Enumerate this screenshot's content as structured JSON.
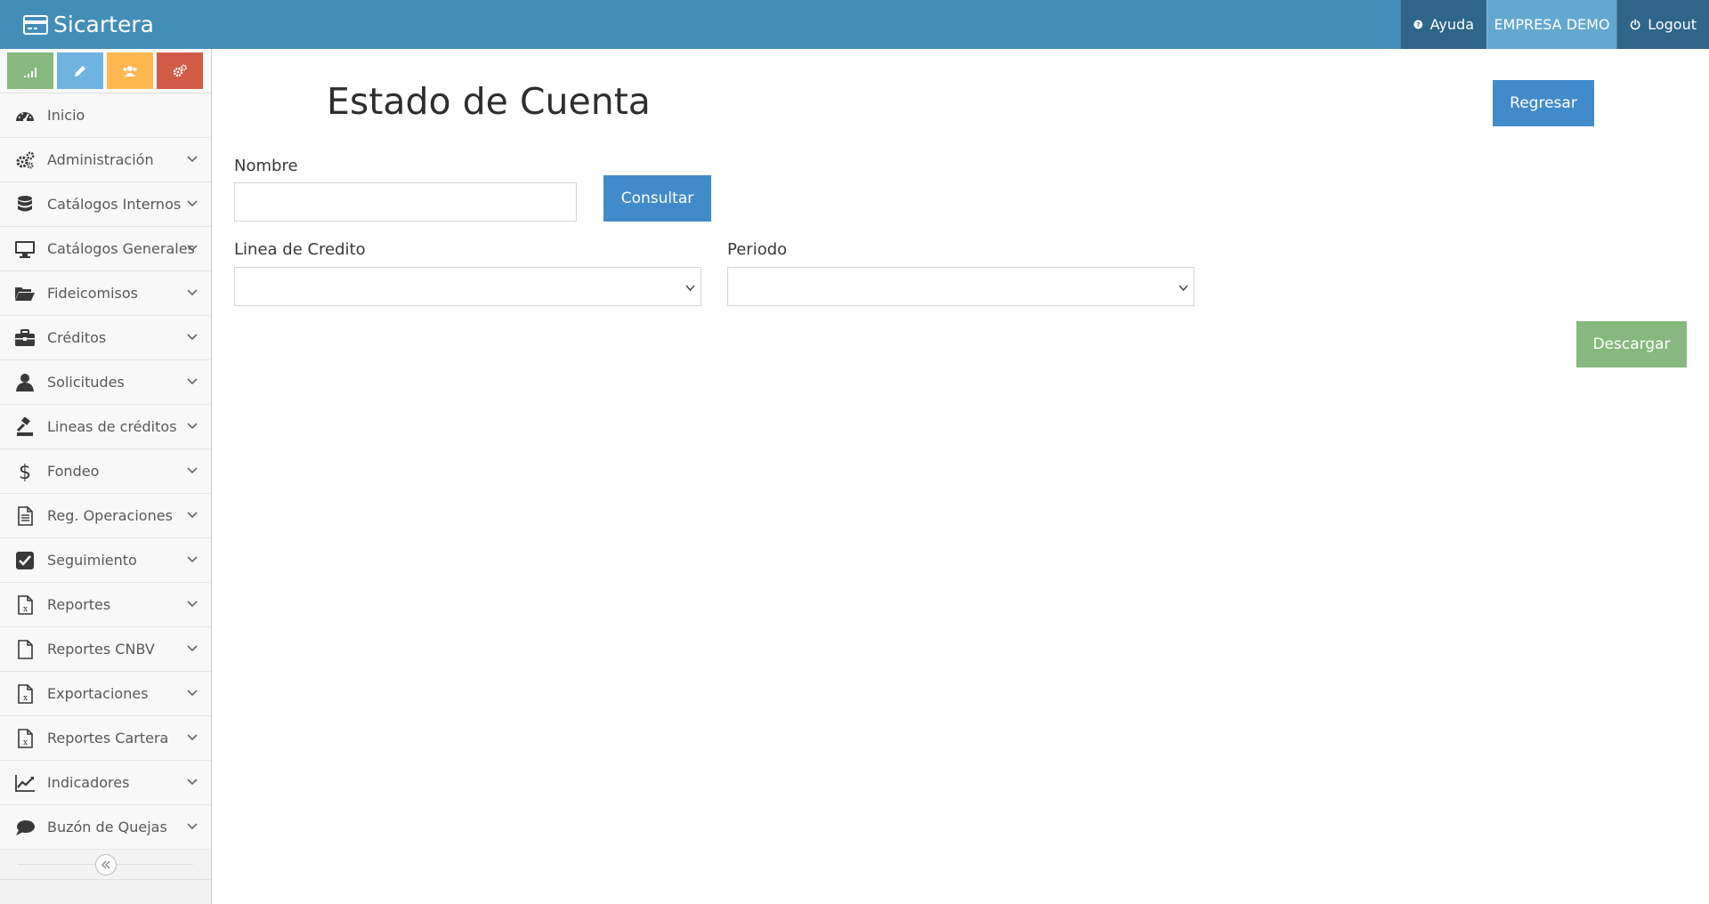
{
  "navbar": {
    "brand": "Sicartera",
    "help_label": "Ayuda",
    "company_label": "EMPRESA DEMO",
    "logout_label": "Logout",
    "colors": {
      "bar": "#438eb9",
      "dark": "#2e6589",
      "light": "#62a8d1"
    }
  },
  "sidebar": {
    "shortcuts": [
      {
        "icon": "signal-icon",
        "color": "#87b87f"
      },
      {
        "icon": "pencil-icon",
        "color": "#6fb3e0"
      },
      {
        "icon": "users-icon",
        "color": "#ffb752"
      },
      {
        "icon": "cogs-icon",
        "color": "#d15b47"
      }
    ],
    "items": [
      {
        "label": "Inicio",
        "icon": "tachometer-icon",
        "has_submenu": false
      },
      {
        "label": "Administración",
        "icon": "cogs-icon",
        "has_submenu": true
      },
      {
        "label": "Catálogos Internos",
        "icon": "database-icon",
        "has_submenu": true
      },
      {
        "label": "Catálogos Generales",
        "icon": "desktop-icon",
        "has_submenu": true
      },
      {
        "label": "Fideicomisos",
        "icon": "folder-open-icon",
        "has_submenu": true
      },
      {
        "label": "Créditos",
        "icon": "briefcase-icon",
        "has_submenu": true
      },
      {
        "label": "Solicitudes",
        "icon": "user-icon",
        "has_submenu": true
      },
      {
        "label": "Lineas de créditos",
        "icon": "gavel-icon",
        "has_submenu": true
      },
      {
        "label": "Fondeo",
        "icon": "dollar-icon",
        "has_submenu": true
      },
      {
        "label": "Reg. Operaciones",
        "icon": "file-text-icon",
        "has_submenu": true
      },
      {
        "label": "Seguimiento",
        "icon": "check-square-icon",
        "has_submenu": true
      },
      {
        "label": "Reportes",
        "icon": "file-excel-icon",
        "has_submenu": true
      },
      {
        "label": "Reportes CNBV",
        "icon": "file-icon",
        "has_submenu": true
      },
      {
        "label": "Exportaciones",
        "icon": "file-excel-icon",
        "has_submenu": true
      },
      {
        "label": "Reportes Cartera",
        "icon": "file-excel-icon",
        "has_submenu": true
      },
      {
        "label": "Indicadores",
        "icon": "line-chart-icon",
        "has_submenu": true
      },
      {
        "label": "Buzón de Quejas",
        "icon": "comment-icon",
        "has_submenu": true
      }
    ]
  },
  "main": {
    "title": "Estado de Cuenta",
    "regresar_label": "Regresar",
    "nombre_label": "Nombre",
    "nombre_value": "",
    "consultar_label": "Consultar",
    "linea_label": "Linea de Credito",
    "linea_value": "",
    "periodo_label": "Periodo",
    "periodo_value": "",
    "descargar_label": "Descargar"
  }
}
